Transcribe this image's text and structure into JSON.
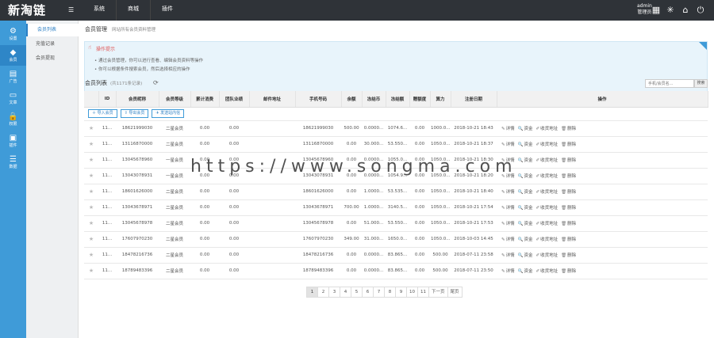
{
  "app": {
    "logo": "新淘链",
    "menu_toggle_icon": "grid-icon"
  },
  "topnav": [
    {
      "label": "系统"
    },
    {
      "label": "商城"
    },
    {
      "label": "插件"
    }
  ],
  "user": {
    "name": "admin",
    "role": "管理员"
  },
  "sidebar": [
    {
      "label": "设置",
      "icon": "gear-icon"
    },
    {
      "label": "会员",
      "icon": "diamond-icon",
      "active": true
    },
    {
      "label": "广告",
      "icon": "ad-icon"
    },
    {
      "label": "文章",
      "icon": "document-icon"
    },
    {
      "label": "权限",
      "icon": "lock-icon"
    },
    {
      "label": "插件",
      "icon": "puzzle-icon"
    },
    {
      "label": "数据",
      "icon": "database-icon"
    }
  ],
  "subnav": [
    {
      "label": "会员列表",
      "active": true
    },
    {
      "label": "充值记录"
    },
    {
      "label": "会员提现"
    }
  ],
  "page": {
    "breadcrumb": "会员管理",
    "breadcrumb_sub": "网站所有会员资料管理",
    "tips_title": "操作提示",
    "tips": [
      "通过会员管理，你可以进行查看、编辑会员资料等操作",
      "你可以根据条件搜索会员，然后选择相应的操作"
    ],
    "list_title": "会员列表",
    "list_count": "(共1171条记录)",
    "search_placeholder": "手机/会员名...",
    "search_button": "搜索"
  },
  "toolbar": [
    "导入会员",
    "导出会员",
    "发送站内信"
  ],
  "columns": [
    "",
    "ID",
    "会员昵称",
    "会员等级",
    "累计消费",
    "团队业绩",
    "邮件地址",
    "手机号码",
    "余额",
    "冻结币",
    "冻结额",
    "赠额度",
    "算力",
    "注册日期",
    "操作"
  ],
  "rows": [
    [
      "11...",
      "18621999030",
      "二星会员",
      "0.00",
      "0.00",
      "",
      "18621999030",
      "500.00",
      "0.0000...",
      "1074.6...",
      "0.00",
      "1000.0...",
      "2018-10-21 18:43"
    ],
    [
      "11...",
      "13116870000",
      "二星会员",
      "0.00",
      "0.00",
      "",
      "13116870000",
      "0.00",
      "30.000...",
      "53.550...",
      "0.00",
      "1050.0...",
      "2018-10-21 18:37"
    ],
    [
      "11...",
      "13045678960",
      "一星会员",
      "0.00",
      "0.00",
      "",
      "13045678960",
      "0.00",
      "0.0000...",
      "1055.0...",
      "0.00",
      "1050.0...",
      "2018-10-21 18:30"
    ],
    [
      "11...",
      "13043078931",
      "一星会员",
      "0.00",
      "0.00",
      "",
      "13043078931",
      "0.00",
      "0.0000...",
      "1054.9...",
      "0.00",
      "1050.0...",
      "2018-10-21 18:20"
    ],
    [
      "11...",
      "18601626000",
      "二星会员",
      "0.00",
      "0.00",
      "",
      "18601626000",
      "0.00",
      "1.0000...",
      "53.535...",
      "0.00",
      "1050.0...",
      "2018-10-21 18:40"
    ],
    [
      "11...",
      "13043678971",
      "二星会员",
      "0.00",
      "0.00",
      "",
      "13043678971",
      "700.00",
      "1.0000...",
      "3140.5...",
      "0.00",
      "1050.0...",
      "2018-10-21 17:54"
    ],
    [
      "11...",
      "13045678978",
      "二星会员",
      "0.00",
      "0.00",
      "",
      "13045678978",
      "0.00",
      "51.000...",
      "53.550...",
      "0.00",
      "1050.0...",
      "2018-10-21 17:53"
    ],
    [
      "11...",
      "17607970230",
      "二星会员",
      "0.00",
      "0.00",
      "",
      "17607970230",
      "349.00",
      "31.000...",
      "1650.0...",
      "0.00",
      "1050.0...",
      "2018-10-03 14:45"
    ],
    [
      "11...",
      "18478216736",
      "二星会员",
      "0.00",
      "0.00",
      "",
      "18478216736",
      "0.00",
      "0.0000...",
      "83.865...",
      "0.00",
      "500.00",
      "2018-07-11 23:58"
    ],
    [
      "11...",
      "18789483396",
      "二星会员",
      "0.00",
      "0.00",
      "",
      "18789483396",
      "0.00",
      "0.0000...",
      "83.865...",
      "0.00",
      "500.00",
      "2018-07-11 23:50"
    ]
  ],
  "row_actions": [
    "详情",
    "资金",
    "收货地址",
    "删除"
  ],
  "pagination": [
    "1",
    "2",
    "3",
    "4",
    "5",
    "6",
    "7",
    "8",
    "9",
    "10",
    "11",
    "下一页",
    "尾页"
  ],
  "watermark": "https://www.songma.com"
}
